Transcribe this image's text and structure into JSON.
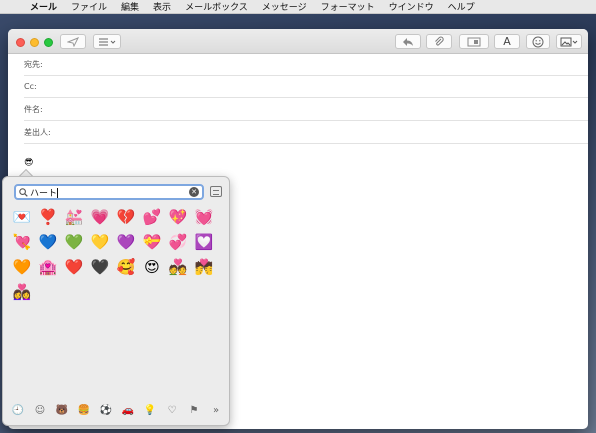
{
  "menubar": {
    "apple": "",
    "items": [
      "メール",
      "ファイル",
      "編集",
      "表示",
      "メールボックス",
      "メッセージ",
      "フォーマット",
      "ウインドウ",
      "ヘルプ"
    ]
  },
  "toolbar": {
    "send_icon": "paper-plane-icon",
    "header_options_icon": "list-icon",
    "reply_icon": "reply-arrow-icon",
    "attach_icon": "paperclip-icon",
    "photo_icon": "photo-browser-icon",
    "format_label": "A",
    "emoji_icon": "smiley-icon",
    "media_icon": "image-dropdown-icon"
  },
  "fields": {
    "to": "宛先:",
    "cc": "Cc:",
    "subject": "件名:",
    "from": "差出人:"
  },
  "body": {
    "emoji": "😎"
  },
  "picker": {
    "search_value": "ハート",
    "results": [
      "💌",
      "❣️",
      "💒",
      "💗",
      "💔",
      "💕",
      "💖",
      "💓",
      "💘",
      "💙",
      "💚",
      "💛",
      "💜",
      "💝",
      "💞",
      "💟",
      "🧡",
      "🏩",
      "❤️",
      "🖤",
      "🥰",
      "😍",
      "💑",
      "💏",
      "👩‍❤️‍👩"
    ],
    "categories": [
      "🕘",
      "☺",
      "🐻",
      "🍔",
      "⚽",
      "🚗",
      "💡",
      "♡",
      "⚑",
      "»"
    ]
  },
  "colors": {
    "accent": "#7ea7e0",
    "close": "#fc5f57",
    "minimize": "#fdbc2e",
    "zoom": "#28c840"
  }
}
